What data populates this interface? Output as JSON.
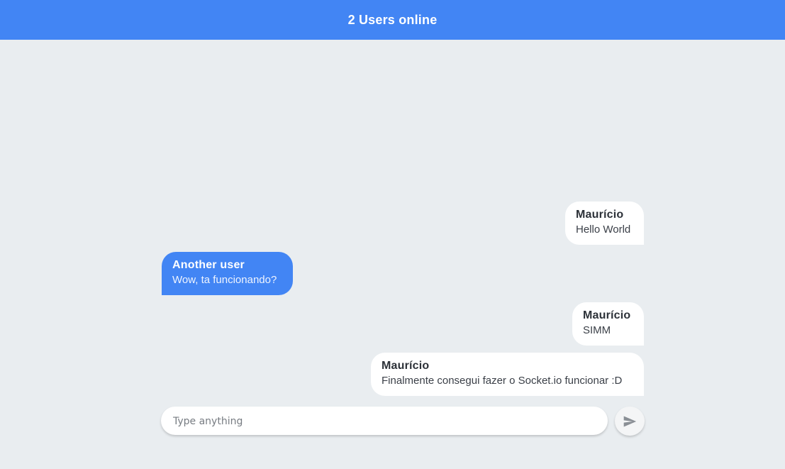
{
  "header": {
    "title": "2 Users online"
  },
  "messages": [
    {
      "author": "Maurício",
      "text": "Hello World",
      "mine": true
    },
    {
      "author": "Another user",
      "text": "Wow, ta funcionando?",
      "mine": false
    },
    {
      "author": "Maurício",
      "text": "SIMM",
      "mine": true
    },
    {
      "author": "Maurício",
      "text": "Finalmente consegui fazer o Socket.io funcionar :D",
      "mine": true
    }
  ],
  "composer": {
    "placeholder": "Type anything",
    "value": "",
    "send_icon": "send-icon"
  },
  "colors": {
    "accent": "#4285f4",
    "background": "#e9edf0",
    "own_bubble": "#ffffff"
  }
}
